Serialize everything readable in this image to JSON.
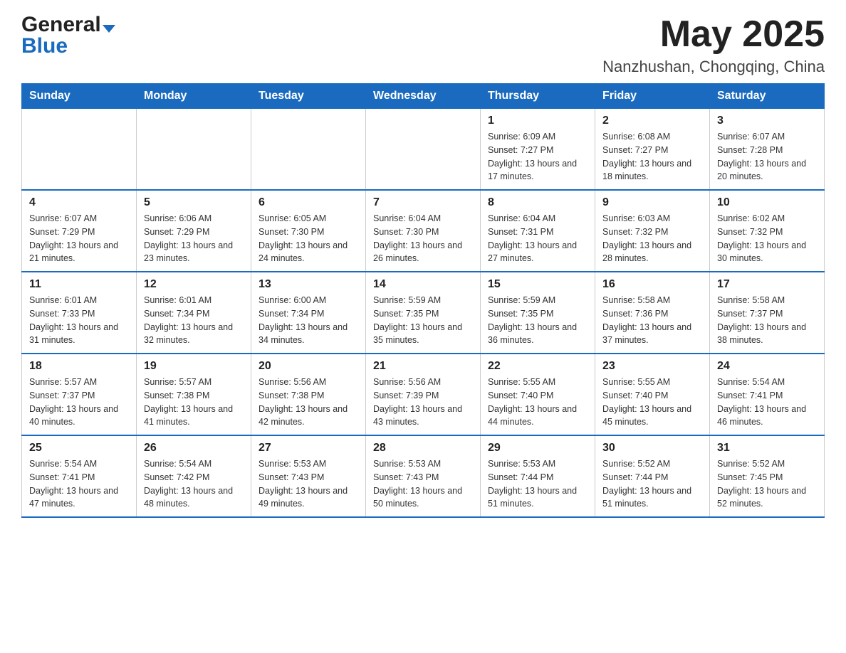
{
  "header": {
    "title": "May 2025",
    "subtitle": "Nanzhushan, Chongqing, China",
    "logo_general": "General",
    "logo_blue": "Blue"
  },
  "calendar": {
    "days_of_week": [
      "Sunday",
      "Monday",
      "Tuesday",
      "Wednesday",
      "Thursday",
      "Friday",
      "Saturday"
    ],
    "weeks": [
      [
        {
          "day": "",
          "info": ""
        },
        {
          "day": "",
          "info": ""
        },
        {
          "day": "",
          "info": ""
        },
        {
          "day": "",
          "info": ""
        },
        {
          "day": "1",
          "info": "Sunrise: 6:09 AM\nSunset: 7:27 PM\nDaylight: 13 hours and 17 minutes."
        },
        {
          "day": "2",
          "info": "Sunrise: 6:08 AM\nSunset: 7:27 PM\nDaylight: 13 hours and 18 minutes."
        },
        {
          "day": "3",
          "info": "Sunrise: 6:07 AM\nSunset: 7:28 PM\nDaylight: 13 hours and 20 minutes."
        }
      ],
      [
        {
          "day": "4",
          "info": "Sunrise: 6:07 AM\nSunset: 7:29 PM\nDaylight: 13 hours and 21 minutes."
        },
        {
          "day": "5",
          "info": "Sunrise: 6:06 AM\nSunset: 7:29 PM\nDaylight: 13 hours and 23 minutes."
        },
        {
          "day": "6",
          "info": "Sunrise: 6:05 AM\nSunset: 7:30 PM\nDaylight: 13 hours and 24 minutes."
        },
        {
          "day": "7",
          "info": "Sunrise: 6:04 AM\nSunset: 7:30 PM\nDaylight: 13 hours and 26 minutes."
        },
        {
          "day": "8",
          "info": "Sunrise: 6:04 AM\nSunset: 7:31 PM\nDaylight: 13 hours and 27 minutes."
        },
        {
          "day": "9",
          "info": "Sunrise: 6:03 AM\nSunset: 7:32 PM\nDaylight: 13 hours and 28 minutes."
        },
        {
          "day": "10",
          "info": "Sunrise: 6:02 AM\nSunset: 7:32 PM\nDaylight: 13 hours and 30 minutes."
        }
      ],
      [
        {
          "day": "11",
          "info": "Sunrise: 6:01 AM\nSunset: 7:33 PM\nDaylight: 13 hours and 31 minutes."
        },
        {
          "day": "12",
          "info": "Sunrise: 6:01 AM\nSunset: 7:34 PM\nDaylight: 13 hours and 32 minutes."
        },
        {
          "day": "13",
          "info": "Sunrise: 6:00 AM\nSunset: 7:34 PM\nDaylight: 13 hours and 34 minutes."
        },
        {
          "day": "14",
          "info": "Sunrise: 5:59 AM\nSunset: 7:35 PM\nDaylight: 13 hours and 35 minutes."
        },
        {
          "day": "15",
          "info": "Sunrise: 5:59 AM\nSunset: 7:35 PM\nDaylight: 13 hours and 36 minutes."
        },
        {
          "day": "16",
          "info": "Sunrise: 5:58 AM\nSunset: 7:36 PM\nDaylight: 13 hours and 37 minutes."
        },
        {
          "day": "17",
          "info": "Sunrise: 5:58 AM\nSunset: 7:37 PM\nDaylight: 13 hours and 38 minutes."
        }
      ],
      [
        {
          "day": "18",
          "info": "Sunrise: 5:57 AM\nSunset: 7:37 PM\nDaylight: 13 hours and 40 minutes."
        },
        {
          "day": "19",
          "info": "Sunrise: 5:57 AM\nSunset: 7:38 PM\nDaylight: 13 hours and 41 minutes."
        },
        {
          "day": "20",
          "info": "Sunrise: 5:56 AM\nSunset: 7:38 PM\nDaylight: 13 hours and 42 minutes."
        },
        {
          "day": "21",
          "info": "Sunrise: 5:56 AM\nSunset: 7:39 PM\nDaylight: 13 hours and 43 minutes."
        },
        {
          "day": "22",
          "info": "Sunrise: 5:55 AM\nSunset: 7:40 PM\nDaylight: 13 hours and 44 minutes."
        },
        {
          "day": "23",
          "info": "Sunrise: 5:55 AM\nSunset: 7:40 PM\nDaylight: 13 hours and 45 minutes."
        },
        {
          "day": "24",
          "info": "Sunrise: 5:54 AM\nSunset: 7:41 PM\nDaylight: 13 hours and 46 minutes."
        }
      ],
      [
        {
          "day": "25",
          "info": "Sunrise: 5:54 AM\nSunset: 7:41 PM\nDaylight: 13 hours and 47 minutes."
        },
        {
          "day": "26",
          "info": "Sunrise: 5:54 AM\nSunset: 7:42 PM\nDaylight: 13 hours and 48 minutes."
        },
        {
          "day": "27",
          "info": "Sunrise: 5:53 AM\nSunset: 7:43 PM\nDaylight: 13 hours and 49 minutes."
        },
        {
          "day": "28",
          "info": "Sunrise: 5:53 AM\nSunset: 7:43 PM\nDaylight: 13 hours and 50 minutes."
        },
        {
          "day": "29",
          "info": "Sunrise: 5:53 AM\nSunset: 7:44 PM\nDaylight: 13 hours and 51 minutes."
        },
        {
          "day": "30",
          "info": "Sunrise: 5:52 AM\nSunset: 7:44 PM\nDaylight: 13 hours and 51 minutes."
        },
        {
          "day": "31",
          "info": "Sunrise: 5:52 AM\nSunset: 7:45 PM\nDaylight: 13 hours and 52 minutes."
        }
      ]
    ]
  }
}
